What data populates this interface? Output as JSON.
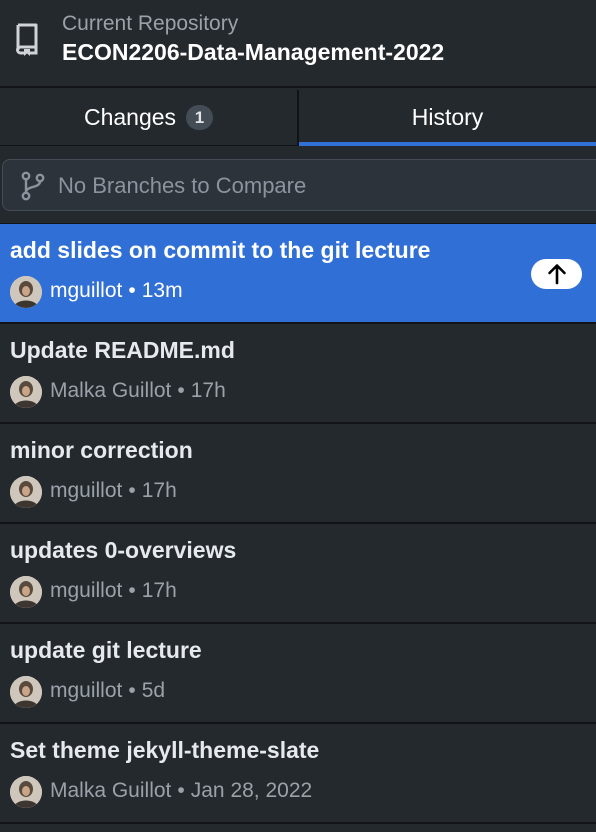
{
  "header": {
    "caption": "Current Repository",
    "repo_name": "ECON2206-Data-Management-2022",
    "icon": "repo-icon"
  },
  "tabs": [
    {
      "label": "Changes",
      "count": "1",
      "active": false
    },
    {
      "label": "History",
      "active": true
    }
  ],
  "compare": {
    "icon": "git-branch-icon",
    "label": "No Branches to Compare"
  },
  "commits": [
    {
      "title": "add slides on commit to the git lecture",
      "author": "mguillot",
      "sep": "•",
      "time": "13m",
      "selected": true,
      "unpushed": true
    },
    {
      "title": "Update README.md",
      "author": "Malka Guillot",
      "sep": "•",
      "time": "17h"
    },
    {
      "title": "minor correction",
      "author": "mguillot",
      "sep": "•",
      "time": "17h"
    },
    {
      "title": "updates 0-overviews",
      "author": "mguillot",
      "sep": "•",
      "time": "17h"
    },
    {
      "title": "update git lecture",
      "author": "mguillot",
      "sep": "•",
      "time": "5d"
    },
    {
      "title": "Set theme jekyll-theme-slate",
      "author": "Malka Guillot",
      "sep": "•",
      "time": "Jan 28, 2022"
    }
  ],
  "colors": {
    "background": "#24292e",
    "selected": "#2f6fd6",
    "divider": "#111317",
    "muted_text": "#9ba1a8"
  }
}
